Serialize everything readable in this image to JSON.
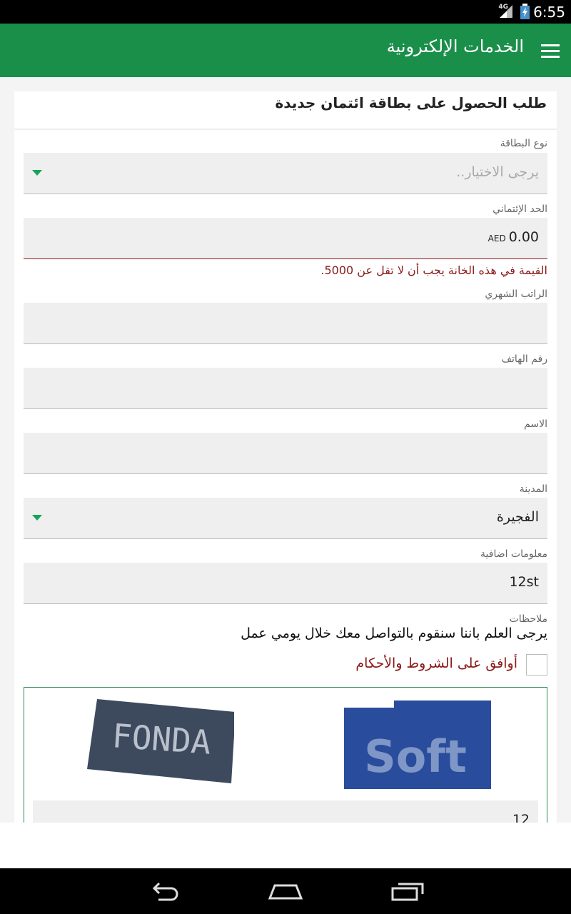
{
  "status_bar": {
    "network": "4G",
    "time": "6:55"
  },
  "toolbar": {
    "title": "الخدمات الإلكترونية",
    "menu_icon": "hamburger-menu-icon"
  },
  "form": {
    "heading": "طلب الحصول على بطاقة ائتمان جديدة",
    "card_type": {
      "label": "نوع البطاقة",
      "placeholder": "يرجى الاختيار.."
    },
    "credit_limit": {
      "label": "الحد الإئتماني",
      "value": "0.00",
      "currency": "AED",
      "error": "القيمة في هذه الخانة يجب أن لا تقل عن 5000."
    },
    "salary": {
      "label": "الراتب الشهري",
      "value": ""
    },
    "phone": {
      "label": "رقم الهاتف",
      "value": ""
    },
    "name": {
      "label": "الاسم",
      "value": ""
    },
    "city": {
      "label": "المدينة",
      "value": "الفجيرة"
    },
    "extra_info": {
      "label": "معلومات اضافية",
      "value": "12st"
    },
    "notes": {
      "label": "ملاحظات",
      "text": "يرجى العلم باننا سنقوم بالتواصل معك خلال يومي عمل"
    },
    "terms": {
      "label": "أوافق على الشروط والأحكام",
      "checked": false
    },
    "captcha": {
      "image_1_text": "FONDA",
      "image_2_text": "Soft",
      "input_value": "12"
    }
  },
  "colors": {
    "primary": "#1a8f4a",
    "error": "#8b1a1a",
    "accent": "#17a35a"
  }
}
